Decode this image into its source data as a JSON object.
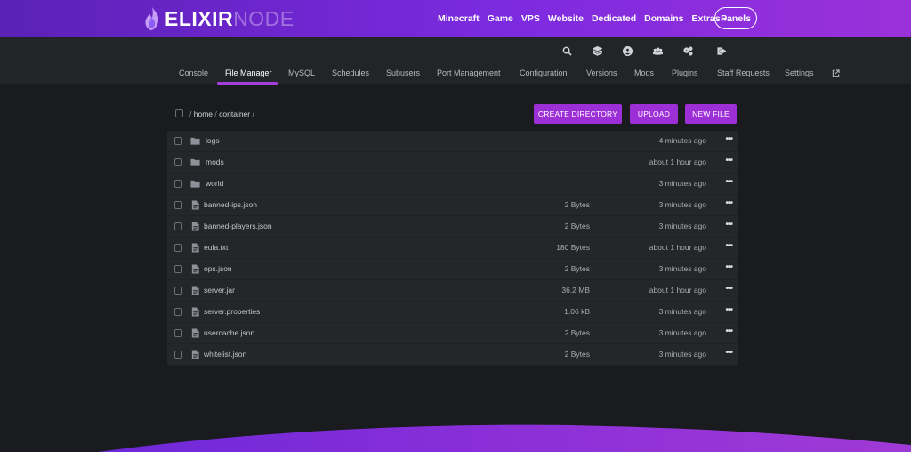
{
  "brand": {
    "word1": "ELIXIR",
    "word2": "NODE"
  },
  "nav": {
    "links": [
      "Minecraft",
      "Game",
      "VPS",
      "Website",
      "Dedicated",
      "Domains"
    ],
    "extras_label": "Extras",
    "panels_label": "Panels"
  },
  "icons": [
    "search-icon",
    "layers-icon",
    "user-circle-icon",
    "users-icon",
    "cogs-icon",
    "sign-out-icon"
  ],
  "tabs": {
    "items": [
      "Console",
      "File Manager",
      "MySQL",
      "Schedules",
      "Subusers",
      "Port Management",
      "Configuration",
      "Versions",
      "Mods",
      "Plugins",
      "Staff Requests",
      "Settings"
    ],
    "active": "File Manager",
    "external_icon": "external-link-icon"
  },
  "breadcrumb": {
    "sep1": "/",
    "home": "home",
    "sep2": "/",
    "container": "container",
    "sep3": "/"
  },
  "buttons": {
    "create_directory": "CREATE DIRECTORY",
    "upload": "UPLOAD",
    "new_file": "NEW FILE"
  },
  "files": [
    {
      "name": "logs",
      "type": "folder",
      "size": "",
      "modified": "4 minutes ago"
    },
    {
      "name": "mods",
      "type": "folder",
      "size": "",
      "modified": "about 1 hour ago"
    },
    {
      "name": "world",
      "type": "folder",
      "size": "",
      "modified": "3 minutes ago"
    },
    {
      "name": "banned-ips.json",
      "type": "file",
      "size": "2 Bytes",
      "modified": "3 minutes ago"
    },
    {
      "name": "banned-players.json",
      "type": "file",
      "size": "2 Bytes",
      "modified": "3 minutes ago"
    },
    {
      "name": "eula.txt",
      "type": "file",
      "size": "180 Bytes",
      "modified": "about 1 hour ago"
    },
    {
      "name": "ops.json",
      "type": "file",
      "size": "2 Bytes",
      "modified": "3 minutes ago"
    },
    {
      "name": "server.jar",
      "type": "file",
      "size": "36.2 MB",
      "modified": "about 1 hour ago"
    },
    {
      "name": "server.properties",
      "type": "file",
      "size": "1.06 kB",
      "modified": "3 minutes ago"
    },
    {
      "name": "usercache.json",
      "type": "file",
      "size": "2 Bytes",
      "modified": "3 minutes ago"
    },
    {
      "name": "whitelist.json",
      "type": "file",
      "size": "2 Bytes",
      "modified": "3 minutes ago"
    }
  ],
  "row_menu_label": "•••",
  "colors": {
    "accent": "#9d2fd6",
    "nav_gradient_start": "#5b21b6",
    "nav_gradient_end": "#9b31d9",
    "background": "#191b1e"
  }
}
